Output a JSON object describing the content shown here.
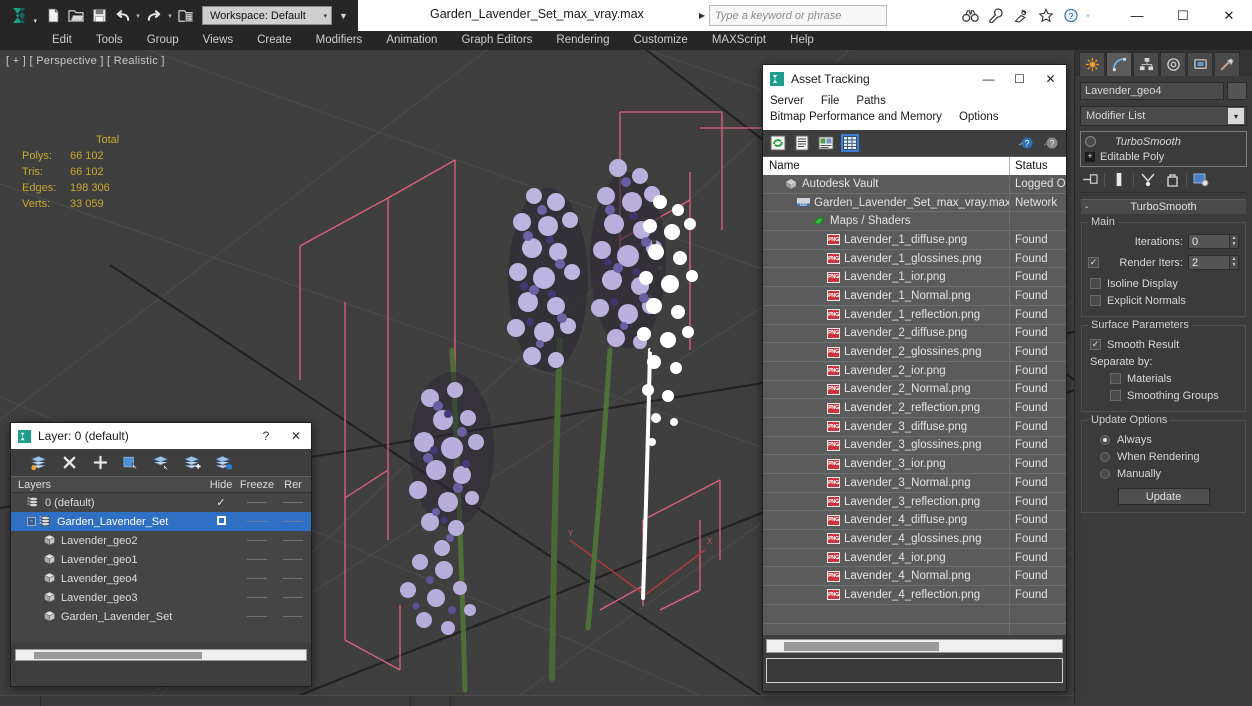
{
  "titlebar": {
    "app_icon": "3dsmax-logo-icon",
    "quick_access": [
      {
        "name": "new-file-button",
        "icon": "new-file-icon"
      },
      {
        "name": "open-file-button",
        "icon": "open-folder-icon"
      },
      {
        "name": "save-file-button",
        "icon": "save-disk-icon"
      },
      {
        "name": "undo-button",
        "icon": "undo-arrow-icon"
      },
      {
        "name": "redo-button",
        "icon": "redo-arrow-icon"
      },
      {
        "name": "set-project-folder-button",
        "icon": "project-folder-icon"
      }
    ],
    "workspace_label": "Workspace: Default",
    "document_title": "Garden_Lavender_Set_max_vray.max",
    "search_placeholder": "Type a keyword or phrase",
    "tool_icons": [
      "binoculars-icon",
      "wrench-icon",
      "satellite-dish-icon",
      "star-icon",
      "help-question-icon"
    ],
    "window_buttons": {
      "minimize": "—",
      "maximize": "☐",
      "close": "✕"
    }
  },
  "menubar": {
    "items": [
      "Edit",
      "Tools",
      "Group",
      "Views",
      "Create",
      "Modifiers",
      "Animation",
      "Graph Editors",
      "Rendering",
      "Customize",
      "MAXScript",
      "Help"
    ]
  },
  "viewport": {
    "label": "[ + ] [ Perspective ] [ Realistic ]",
    "stats": {
      "header": "Total",
      "rows": [
        {
          "key": "Polys:",
          "value": "66 102"
        },
        {
          "key": "Tris:",
          "value": "66 102"
        },
        {
          "key": "Edges:",
          "value": "198 306"
        },
        {
          "key": "Verts:",
          "value": "33 059"
        }
      ]
    },
    "colors": {
      "background": "#3f3f3f",
      "grid": "#4a4a4a",
      "selection_bbox": "#e0627f",
      "flower_petal": "#b7aedb",
      "flower_dark": "#4b3d78",
      "stem": "#4f7038",
      "selected_white": "#ffffff",
      "axis_red": "#b03a3a"
    }
  },
  "asset_tracking": {
    "title": "Asset Tracking",
    "icon": "3dsmax-dialog-icon",
    "window_buttons": {
      "minimize": "—",
      "maximize": "☐",
      "close": "✕"
    },
    "menus_row1": [
      "Server",
      "File",
      "Paths"
    ],
    "menus_row2": [
      "Bitmap Performance and Memory",
      "Options"
    ],
    "toolbar": [
      {
        "name": "refresh-button",
        "icon": "refresh-green-icon",
        "selected": false
      },
      {
        "name": "list-view-button",
        "icon": "list-lines-icon",
        "selected": false
      },
      {
        "name": "thumbnail-view-button",
        "icon": "thumbnail-icon",
        "selected": false
      },
      {
        "name": "grid-view-button",
        "icon": "grid-table-icon",
        "selected": true
      }
    ],
    "toolbar_right": [
      {
        "name": "help-blue-button",
        "icon": "help-blue-icon"
      },
      {
        "name": "help-gray-button",
        "icon": "help-gray-icon"
      }
    ],
    "columns": [
      "Name",
      "Status"
    ],
    "rows": [
      {
        "name": "Autodesk Vault",
        "status": "Logged O",
        "indent": 0,
        "icon": "vault-icon"
      },
      {
        "name": "Garden_Lavender_Set_max_vray.max",
        "status": "Network",
        "indent": 1,
        "icon": "max-file-icon"
      },
      {
        "name": "Maps / Shaders",
        "status": "",
        "indent": 2,
        "icon": "maps-green-icon"
      },
      {
        "name": "Lavender_1_diffuse.png",
        "status": "Found",
        "indent": 3,
        "icon": "png-icon"
      },
      {
        "name": "Lavender_1_glossines.png",
        "status": "Found",
        "indent": 3,
        "icon": "png-icon"
      },
      {
        "name": "Lavender_1_ior.png",
        "status": "Found",
        "indent": 3,
        "icon": "png-icon"
      },
      {
        "name": "Lavender_1_Normal.png",
        "status": "Found",
        "indent": 3,
        "icon": "png-icon"
      },
      {
        "name": "Lavender_1_reflection.png",
        "status": "Found",
        "indent": 3,
        "icon": "png-icon"
      },
      {
        "name": "Lavender_2_diffuse.png",
        "status": "Found",
        "indent": 3,
        "icon": "png-icon"
      },
      {
        "name": "Lavender_2_glossines.png",
        "status": "Found",
        "indent": 3,
        "icon": "png-icon"
      },
      {
        "name": "Lavender_2_ior.png",
        "status": "Found",
        "indent": 3,
        "icon": "png-icon"
      },
      {
        "name": "Lavender_2_Normal.png",
        "status": "Found",
        "indent": 3,
        "icon": "png-icon"
      },
      {
        "name": "Lavender_2_reflection.png",
        "status": "Found",
        "indent": 3,
        "icon": "png-icon"
      },
      {
        "name": "Lavender_3_diffuse.png",
        "status": "Found",
        "indent": 3,
        "icon": "png-icon"
      },
      {
        "name": "Lavender_3_glossines.png",
        "status": "Found",
        "indent": 3,
        "icon": "png-icon"
      },
      {
        "name": "Lavender_3_ior.png",
        "status": "Found",
        "indent": 3,
        "icon": "png-icon"
      },
      {
        "name": "Lavender_3_Normal.png",
        "status": "Found",
        "indent": 3,
        "icon": "png-icon"
      },
      {
        "name": "Lavender_3_reflection.png",
        "status": "Found",
        "indent": 3,
        "icon": "png-icon"
      },
      {
        "name": "Lavender_4_diffuse.png",
        "status": "Found",
        "indent": 3,
        "icon": "png-icon"
      },
      {
        "name": "Lavender_4_glossines.png",
        "status": "Found",
        "indent": 3,
        "icon": "png-icon"
      },
      {
        "name": "Lavender_4_ior.png",
        "status": "Found",
        "indent": 3,
        "icon": "png-icon"
      },
      {
        "name": "Lavender_4_Normal.png",
        "status": "Found",
        "indent": 3,
        "icon": "png-icon"
      },
      {
        "name": "Lavender_4_reflection.png",
        "status": "Found",
        "indent": 3,
        "icon": "png-icon"
      },
      {
        "name": "",
        "status": "",
        "indent": 0,
        "icon": "none"
      },
      {
        "name": "",
        "status": "",
        "indent": 0,
        "icon": "none"
      }
    ]
  },
  "layer_window": {
    "title": "Layer: 0 (default)",
    "icon": "3dsmax-dialog-icon",
    "help_button": "?",
    "close_button": "✕",
    "toolbar": [
      {
        "name": "new-layer-button",
        "icon": "new-layer-icon"
      },
      {
        "name": "delete-layer-button",
        "icon": "delete-x-icon"
      },
      {
        "name": "add-layer-button",
        "icon": "plus-icon"
      },
      {
        "name": "select-objects-in-layer-button",
        "icon": "select-layer-objects-icon"
      },
      {
        "name": "highlight-selected-objects-layer-button",
        "icon": "highlight-layer-icon"
      },
      {
        "name": "add-selection-to-layer-button",
        "icon": "add-selection-layer-icon"
      },
      {
        "name": "set-current-layer-button",
        "icon": "set-current-layer-icon"
      }
    ],
    "columns": [
      "Layers",
      "Hide",
      "Freeze",
      "Rer"
    ],
    "rows": [
      {
        "label": "0 (default)",
        "indent": 0,
        "selected": false,
        "expander": false,
        "icon": "layer-icon",
        "hide": "",
        "mark": "check"
      },
      {
        "label": "Garden_Lavender_Set",
        "indent": 0,
        "selected": true,
        "expander": true,
        "icon": "layer-icon",
        "hide": "",
        "mark": "box"
      },
      {
        "label": "Lavender_geo2",
        "indent": 1,
        "selected": false,
        "expander": false,
        "icon": "object-icon",
        "hide": "",
        "mark": ""
      },
      {
        "label": "Lavender_geo1",
        "indent": 1,
        "selected": false,
        "expander": false,
        "icon": "object-icon",
        "hide": "",
        "mark": ""
      },
      {
        "label": "Lavender_geo4",
        "indent": 1,
        "selected": false,
        "expander": false,
        "icon": "object-icon",
        "hide": "",
        "mark": ""
      },
      {
        "label": "Lavender_geo3",
        "indent": 1,
        "selected": false,
        "expander": false,
        "icon": "object-icon",
        "hide": "",
        "mark": ""
      },
      {
        "label": "Garden_Lavender_Set",
        "indent": 1,
        "selected": false,
        "expander": false,
        "icon": "object-icon",
        "hide": "",
        "mark": ""
      }
    ]
  },
  "command_panel": {
    "tabs": [
      {
        "name": "create-tab",
        "icon": "create-star-icon",
        "active": false
      },
      {
        "name": "modify-tab",
        "icon": "modify-curve-icon",
        "active": true
      },
      {
        "name": "hierarchy-tab",
        "icon": "hierarchy-icon",
        "active": false
      },
      {
        "name": "motion-tab",
        "icon": "motion-wheel-icon",
        "active": false
      },
      {
        "name": "display-tab",
        "icon": "display-monitor-icon",
        "active": false
      },
      {
        "name": "utilities-tab",
        "icon": "utilities-hammer-icon",
        "active": false
      }
    ],
    "object_name": "Lavender_geo4",
    "modifier_list_label": "Modifier List",
    "modifier_stack": [
      {
        "label": "TurboSmooth",
        "italic": true,
        "icon": "lightbulb-icon"
      },
      {
        "label": "Editable Poly",
        "italic": false,
        "icon": "plus-box-icon"
      }
    ],
    "stack_buttons": [
      {
        "name": "pin-stack-button",
        "icon": "pin-stack-icon"
      },
      {
        "name": "show-end-result-button",
        "icon": "show-end-result-icon"
      },
      {
        "name": "make-unique-button",
        "icon": "make-unique-icon"
      },
      {
        "name": "remove-modifier-button",
        "icon": "trash-modifier-icon"
      },
      {
        "name": "configure-modifier-sets-button",
        "icon": "configure-sets-icon"
      }
    ],
    "rollout": {
      "title": "TurboSmooth",
      "collapse_icon": "-",
      "main_group": {
        "title": "Main",
        "iterations_label": "Iterations:",
        "iterations_value": "0",
        "render_iters_label": "Render Iters:",
        "render_iters_value": "2",
        "render_iters_checked": true,
        "isoline_display_label": "Isoline Display",
        "isoline_display_checked": false,
        "explicit_normals_label": "Explicit Normals",
        "explicit_normals_checked": false
      },
      "surface_group": {
        "title": "Surface Parameters",
        "smooth_result_label": "Smooth Result",
        "smooth_result_checked": true,
        "separate_by_label": "Separate by:",
        "materials_label": "Materials",
        "materials_checked": false,
        "smoothing_groups_label": "Smoothing Groups",
        "smoothing_groups_checked": false
      },
      "update_group": {
        "title": "Update Options",
        "options": [
          {
            "label": "Always",
            "selected": true
          },
          {
            "label": "When Rendering",
            "selected": false
          },
          {
            "label": "Manually",
            "selected": false
          }
        ],
        "update_button": "Update"
      }
    }
  }
}
